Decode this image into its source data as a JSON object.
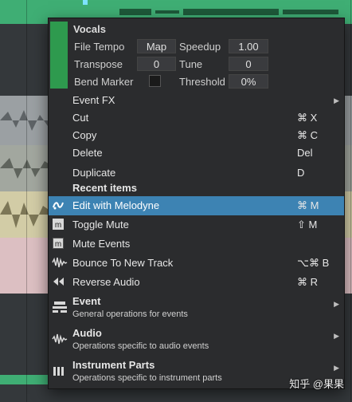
{
  "header": {
    "title": "Vocals",
    "color": "#2e9a4e",
    "file_tempo_label": "File Tempo",
    "file_tempo_value": "Map",
    "speedup_label": "Speedup",
    "speedup_value": "1.00",
    "transpose_label": "Transpose",
    "transpose_value": "0",
    "tune_label": "Tune",
    "tune_value": "0",
    "bend_marker_label": "Bend Marker",
    "threshold_label": "Threshold",
    "threshold_value": "0%"
  },
  "items": {
    "event_fx": {
      "label": "Event FX"
    },
    "cut": {
      "label": "Cut",
      "shortcut": "⌘ X"
    },
    "copy": {
      "label": "Copy",
      "shortcut": "⌘ C"
    },
    "delete": {
      "label": "Delete",
      "shortcut": "Del"
    },
    "duplicate": {
      "label": "Duplicate",
      "shortcut": "D"
    },
    "recent_title": "Recent items",
    "edit_melodyne": {
      "label": "Edit with Melodyne",
      "shortcut": "⌘ M"
    },
    "toggle_mute": {
      "label": "Toggle Mute",
      "shortcut": "⇧ M"
    },
    "mute_events": {
      "label": "Mute Events"
    },
    "bounce": {
      "label": "Bounce To New Track",
      "shortcut": "⌥⌘ B"
    },
    "reverse": {
      "label": "Reverse Audio",
      "shortcut": "⌘ R"
    }
  },
  "groups": {
    "event": {
      "title": "Event",
      "desc": "General operations for events"
    },
    "audio": {
      "title": "Audio",
      "desc": "Operations specific to audio events"
    },
    "instrument": {
      "title": "Instrument Parts",
      "desc": "Operations specific to instrument parts"
    }
  },
  "watermark": "知乎 @果果",
  "colors": {
    "highlight": "#3d83b3",
    "menu_bg": "#2b2c2e",
    "track_green": "#3fae74"
  }
}
